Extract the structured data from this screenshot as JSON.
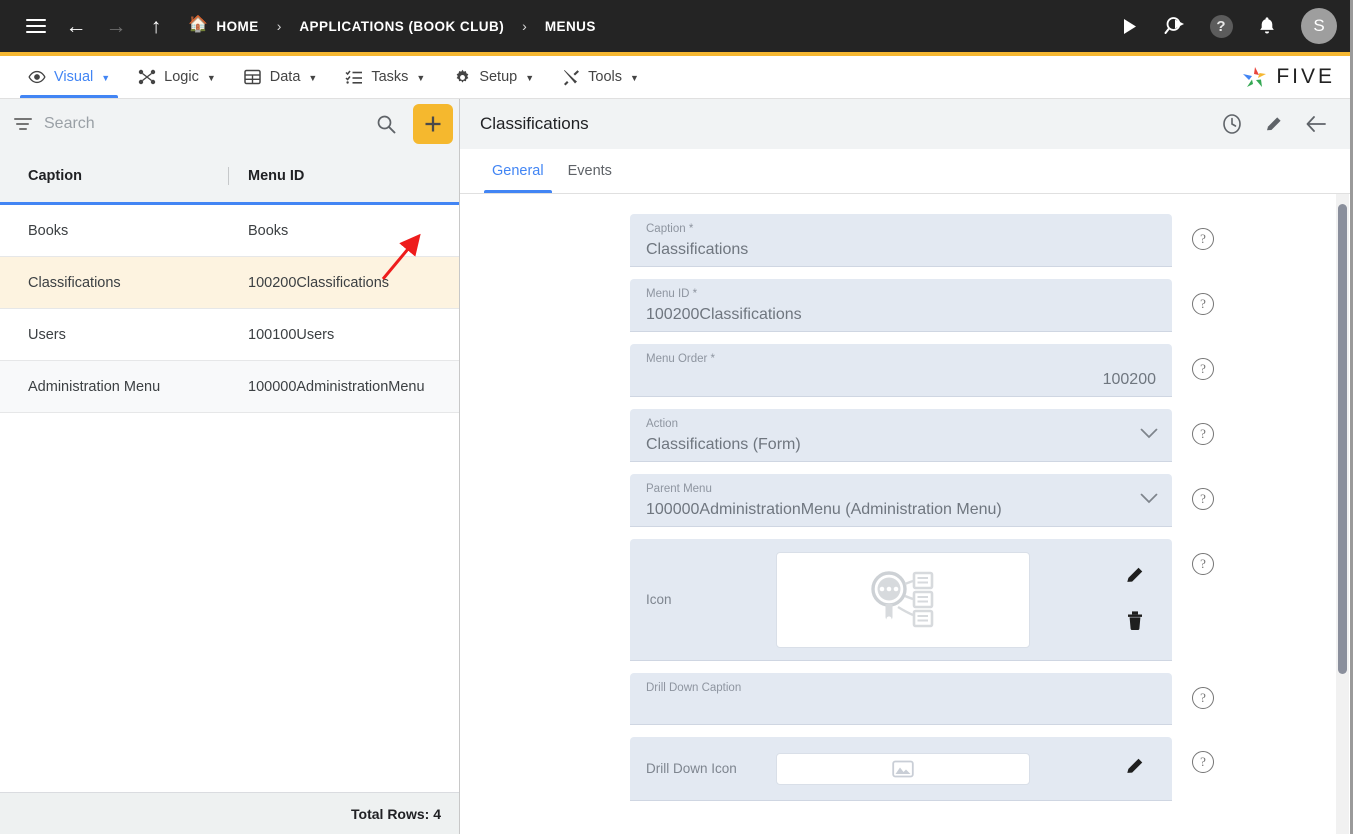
{
  "topbar": {
    "menu_icon": "hamburger-icon",
    "back_icon": "arrow-left-icon",
    "forward_icon": "arrow-right-icon",
    "up_icon": "arrow-up-icon",
    "breadcrumbs": [
      {
        "label": "HOME",
        "icon": "home-icon"
      },
      {
        "label": "APPLICATIONS (BOOK CLUB)",
        "icon": ""
      },
      {
        "label": "MENUS",
        "icon": ""
      }
    ],
    "separator": "›",
    "actions": {
      "run_label": "run-icon",
      "debug_label": "search-run-icon",
      "help_label": "?",
      "notifications_label": "bell-icon",
      "avatar_initial": "S"
    },
    "accent_color": "#F5B731",
    "background_color": "#242424"
  },
  "menubar": {
    "items": [
      {
        "label": "Visual",
        "icon": "eye-icon",
        "active": true
      },
      {
        "label": "Logic",
        "icon": "nodes-icon",
        "active": false
      },
      {
        "label": "Data",
        "icon": "table-icon",
        "active": false
      },
      {
        "label": "Tasks",
        "icon": "checklist-icon",
        "active": false
      },
      {
        "label": "Setup",
        "icon": "gear-icon",
        "active": false
      },
      {
        "label": "Tools",
        "icon": "tools-icon",
        "active": false
      }
    ],
    "caret": "▼",
    "brand": "FIVE",
    "active_color": "#4285f4"
  },
  "left_panel": {
    "search": {
      "placeholder": "Search",
      "value": "",
      "filter_icon": "filter-icon",
      "search_icon": "magnifier-icon"
    },
    "add_button": {
      "label": "+",
      "color": "#F5B82E"
    },
    "columns": [
      "Caption",
      "Menu ID"
    ],
    "rows": [
      {
        "caption": "Books",
        "menu_id": "Books"
      },
      {
        "caption": "Classifications",
        "menu_id": "100200Classifications"
      },
      {
        "caption": "Users",
        "menu_id": "100100Users"
      },
      {
        "caption": "Administration Menu",
        "menu_id": "100000AdministrationMenu"
      }
    ],
    "selected_row_index": 1,
    "footer": "Total Rows: 4",
    "annotation": {
      "type": "arrow",
      "color": "#ee1c1c",
      "points_to": "add-button"
    }
  },
  "right_panel": {
    "title": "Classifications",
    "header_actions": [
      {
        "name": "history-icon",
        "glyph": "clock"
      },
      {
        "name": "edit-icon",
        "glyph": "pencil"
      },
      {
        "name": "back-icon",
        "glyph": "arrow-left"
      }
    ],
    "tabs": [
      {
        "label": "General",
        "active": true
      },
      {
        "label": "Events",
        "active": false
      }
    ],
    "fields": [
      {
        "label": "Caption *",
        "value": "Classifications",
        "type": "text",
        "align": "left"
      },
      {
        "label": "Menu ID *",
        "value": "100200Classifications",
        "type": "text",
        "align": "left"
      },
      {
        "label": "Menu Order *",
        "value": "100200",
        "type": "number",
        "align": "right"
      },
      {
        "label": "Action",
        "value": "Classifications (Form)",
        "type": "select",
        "align": "left"
      },
      {
        "label": "Parent Menu",
        "value": "100000AdministrationMenu (Administration Menu)",
        "type": "select",
        "align": "left"
      },
      {
        "label": "Icon",
        "value": "",
        "type": "image",
        "image_name": "classification-magnifier-icon",
        "has_delete": true
      },
      {
        "label": "Drill Down Caption",
        "value": "",
        "type": "text",
        "align": "left"
      },
      {
        "label": "Drill Down Icon",
        "value": "",
        "type": "image-small",
        "image_name": "image-placeholder-icon",
        "has_delete": false
      }
    ],
    "help_glyph": "?",
    "field_background": "#e3e9f2"
  }
}
